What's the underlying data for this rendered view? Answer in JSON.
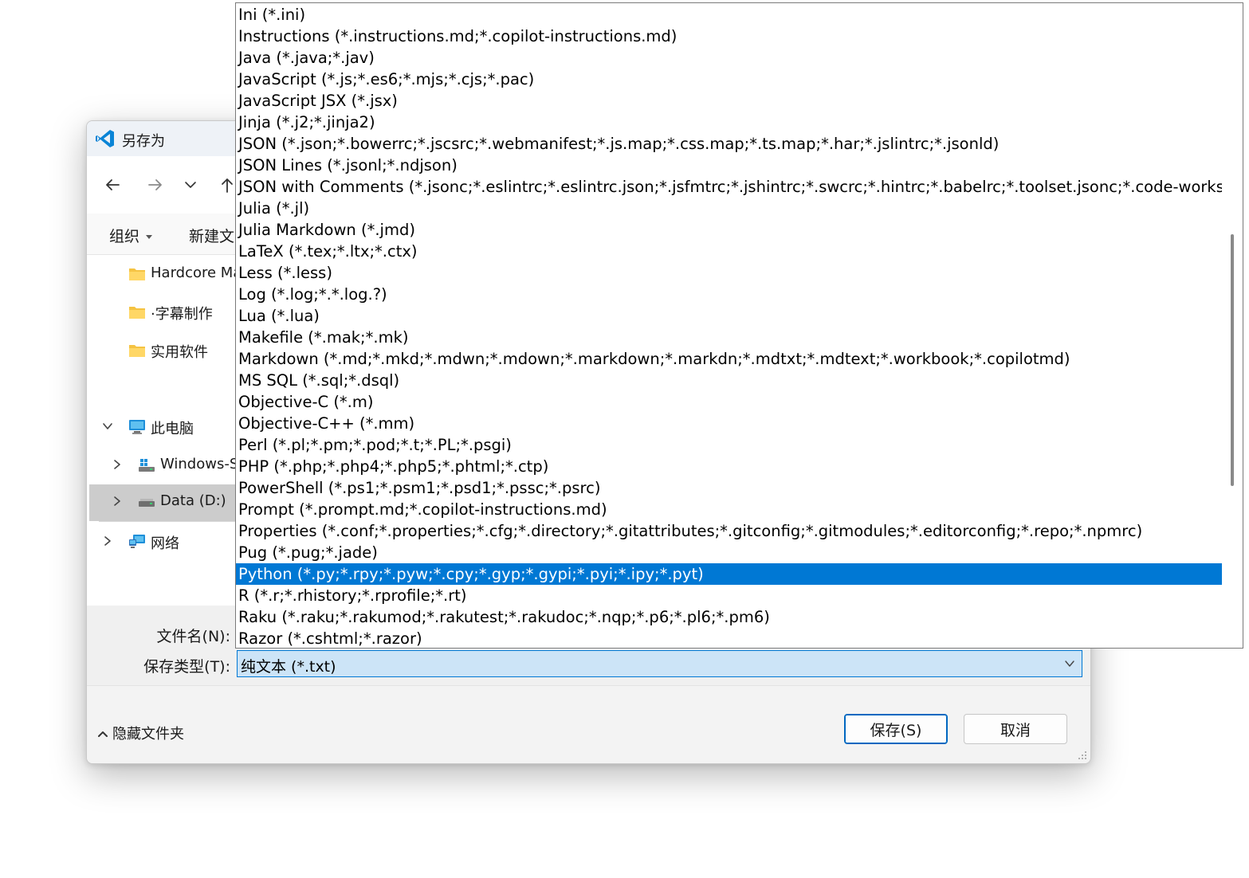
{
  "window": {
    "title": "另存为"
  },
  "toolbar": {
    "organize": "组织",
    "new_folder": "新建文"
  },
  "sidebar": {
    "items": [
      {
        "label": "Hardcore Ma",
        "icon": "folder-icon"
      },
      {
        "label": "·字幕制作",
        "icon": "folder-icon"
      },
      {
        "label": "实用软件",
        "icon": "folder-icon"
      },
      {
        "label": "此电脑",
        "icon": "computer-icon"
      },
      {
        "label": "Windows-S",
        "icon": "drive-icon"
      },
      {
        "label": "Data (D:)",
        "icon": "drive-icon"
      },
      {
        "label": "网络",
        "icon": "network-icon"
      }
    ]
  },
  "form": {
    "filename_label": "文件名(N):",
    "type_label": "保存类型(T):",
    "type_value": "纯文本 (*.txt)"
  },
  "footer": {
    "hide_folders": "隐藏文件夹",
    "save": "保存(S)",
    "cancel": "取消"
  },
  "colors": {
    "accent": "#0078d4",
    "select_bg": "#cce4f7"
  },
  "dropdown": {
    "selected_index": 26,
    "items": [
      "Ini (*.ini)",
      "Instructions (*.instructions.md;*.copilot-instructions.md)",
      "Java (*.java;*.jav)",
      "JavaScript (*.js;*.es6;*.mjs;*.cjs;*.pac)",
      "JavaScript JSX (*.jsx)",
      "Jinja (*.j2;*.jinja2)",
      "JSON (*.json;*.bowerrc;*.jscsrc;*.webmanifest;*.js.map;*.css.map;*.ts.map;*.har;*.jslintrc;*.jsonld)",
      "JSON Lines (*.jsonl;*.ndjson)",
      "JSON with Comments (*.jsonc;*.eslintrc;*.eslintrc.json;*.jsfmtrc;*.jshintrc;*.swcrc;*.hintrc;*.babelrc;*.toolset.jsonc;*.code-workspace)",
      "Julia (*.jl)",
      "Julia Markdown (*.jmd)",
      "LaTeX (*.tex;*.ltx;*.ctx)",
      "Less (*.less)",
      "Log (*.log;*.*.log.?)",
      "Lua (*.lua)",
      "Makefile (*.mak;*.mk)",
      "Markdown (*.md;*.mkd;*.mdwn;*.mdown;*.markdown;*.markdn;*.mdtxt;*.mdtext;*.workbook;*.copilotmd)",
      "MS SQL (*.sql;*.dsql)",
      "Objective-C (*.m)",
      "Objective-C++ (*.mm)",
      "Perl (*.pl;*.pm;*.pod;*.t;*.PL;*.psgi)",
      "PHP (*.php;*.php4;*.php5;*.phtml;*.ctp)",
      "PowerShell (*.ps1;*.psm1;*.psd1;*.pssc;*.psrc)",
      "Prompt (*.prompt.md;*.copilot-instructions.md)",
      "Properties (*.conf;*.properties;*.cfg;*.directory;*.gitattributes;*.gitconfig;*.gitmodules;*.editorconfig;*.repo;*.npmrc)",
      "Pug (*.pug;*.jade)",
      "Python (*.py;*.rpy;*.pyw;*.cpy;*.gyp;*.gypi;*.pyi;*.ipy;*.pyt)",
      "R (*.r;*.rhistory;*.rprofile;*.rt)",
      "Raku (*.raku;*.rakumod;*.rakutest;*.rakudoc;*.nqp;*.p6;*.pl6;*.pm6)",
      "Razor (*.cshtml;*.razor)"
    ]
  }
}
